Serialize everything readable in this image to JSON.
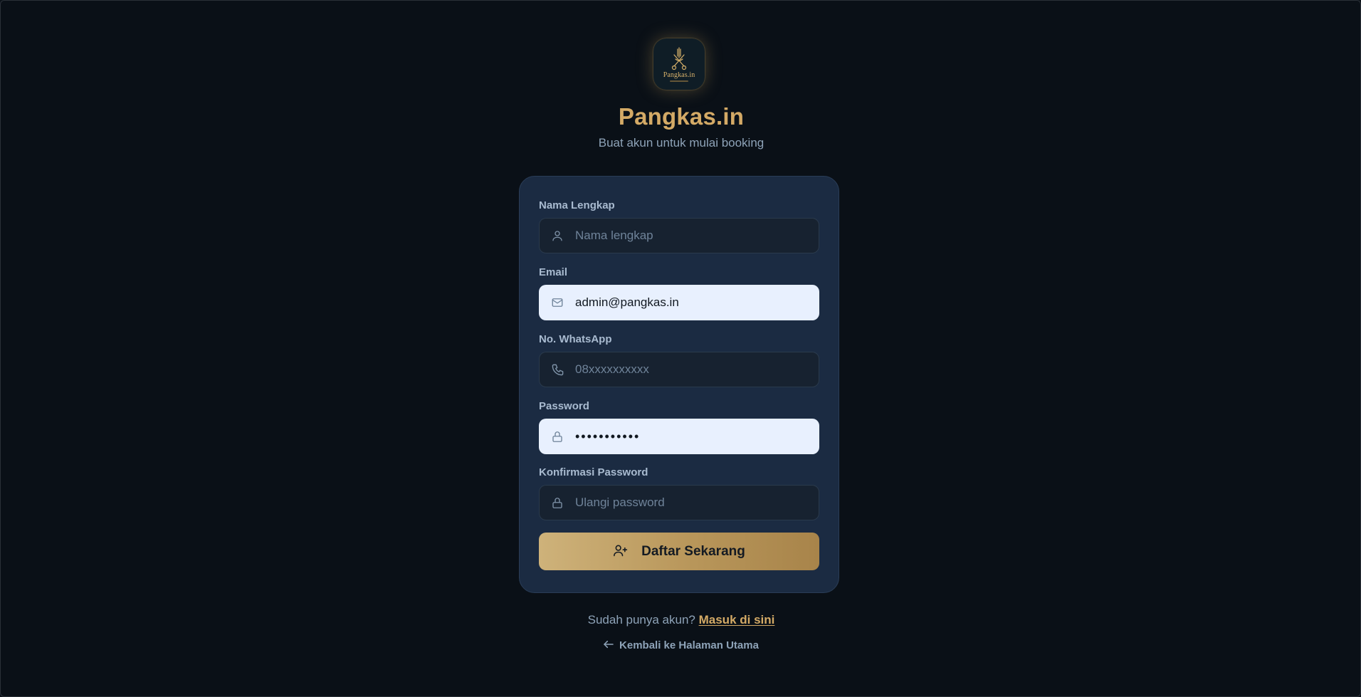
{
  "brand": {
    "logo_text": "Pangkas.in",
    "name": "Pangkas.in",
    "subtitle": "Buat akun untuk mulai booking"
  },
  "form": {
    "full_name": {
      "label": "Nama Lengkap",
      "value": "",
      "placeholder": "Nama lengkap",
      "icon": "user-icon"
    },
    "email": {
      "label": "Email",
      "value": "admin@pangkas.in",
      "placeholder": "",
      "icon": "mail-icon"
    },
    "whatsapp": {
      "label": "No. WhatsApp",
      "value": "",
      "placeholder": "08xxxxxxxxxx",
      "icon": "phone-icon"
    },
    "password": {
      "label": "Password",
      "value": "•••••••••••",
      "placeholder": "",
      "icon": "lock-icon"
    },
    "confirm_password": {
      "label": "Konfirmasi Password",
      "value": "",
      "placeholder": "Ulangi password",
      "icon": "lock-icon"
    },
    "submit_label": "Daftar Sekarang",
    "submit_icon": "user-plus-icon"
  },
  "footer": {
    "have_account_text": "Sudah punya akun?",
    "login_link": "Masuk di sini",
    "back_link": "Kembali ke Halaman Utama"
  },
  "colors": {
    "background": "#0a1017",
    "card": "#1b2b42",
    "accent_gold": "#d4aa66",
    "autofill_bg": "#e8f0fe"
  }
}
